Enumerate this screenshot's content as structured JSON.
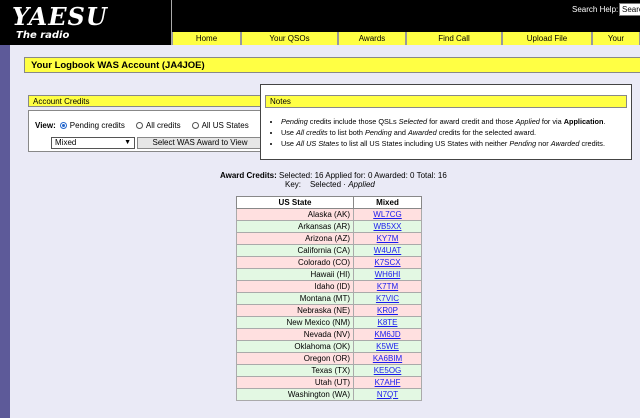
{
  "header": {
    "logo_text": "YAESU",
    "logo_sub": "The radio",
    "search_label": "Search Help:",
    "search_value": "Searc"
  },
  "nav": [
    {
      "label": "Home"
    },
    {
      "label": "Your QSOs"
    },
    {
      "label": "Awards"
    },
    {
      "label": "Find Call"
    },
    {
      "label": "Upload File"
    },
    {
      "label": "Your"
    }
  ],
  "page_title": "Your Logbook WAS Account (JA4JOE)",
  "account_credits": {
    "title": "Account Credits",
    "view_label": "View:",
    "options": [
      "Pending credits",
      "All credits",
      "All US States"
    ],
    "selected_option": "Pending credits",
    "select_value": "Mixed",
    "button_label": "Select WAS Award to View"
  },
  "notes": {
    "title": "Notes",
    "items": [
      {
        "a": "Pending",
        "b": " credits include those QSLs ",
        "c": "Selected",
        "d": " for award credit and those ",
        "e": "Applied",
        "f": " for via ",
        "g": "Application",
        "h": "."
      },
      {
        "a": "Use ",
        "b": "All credits",
        "c": " to list both ",
        "d": "Pending",
        "e": " and ",
        "f": "Awarded",
        "g": " credits for the selected award.",
        "h": ""
      },
      {
        "a": "Use ",
        "b": "All US States",
        "c": " to list all US States including US States with neither ",
        "d": "Pending",
        "e": " nor ",
        "f": "Awarded",
        "g": " credits.",
        "h": ""
      }
    ]
  },
  "summary": {
    "label": "Award Credits:",
    "text": "Selected: 16 Applied for: 0 Awarded: 0 Total: 16",
    "key_label": "Key:",
    "key_selected": "Selected",
    "key_sep": " · ",
    "key_applied": "Applied"
  },
  "table": {
    "headers": [
      "US State",
      "Mixed"
    ],
    "rows": [
      {
        "state": "Alaska (AK)",
        "call": "WL7CG",
        "status": "pink"
      },
      {
        "state": "Arkansas (AR)",
        "call": "WB5XX",
        "status": "green"
      },
      {
        "state": "Arizona (AZ)",
        "call": "KY7M",
        "status": "pink"
      },
      {
        "state": "California (CA)",
        "call": "W4UAT",
        "status": "green"
      },
      {
        "state": "Colorado (CO)",
        "call": "K7SCX",
        "status": "pink"
      },
      {
        "state": "Hawaii (HI)",
        "call": "WH6HI",
        "status": "green"
      },
      {
        "state": "Idaho (ID)",
        "call": "K7TM",
        "status": "pink"
      },
      {
        "state": "Montana (MT)",
        "call": "K7VIC",
        "status": "green"
      },
      {
        "state": "Nebraska (NE)",
        "call": "KR0P",
        "status": "pink"
      },
      {
        "state": "New Mexico (NM)",
        "call": "K8TE",
        "status": "green"
      },
      {
        "state": "Nevada (NV)",
        "call": "KM6JD",
        "status": "pink"
      },
      {
        "state": "Oklahoma (OK)",
        "call": "K5WE",
        "status": "green"
      },
      {
        "state": "Oregon (OR)",
        "call": "KA6BIM",
        "status": "pink"
      },
      {
        "state": "Texas (TX)",
        "call": "KE5OG",
        "status": "green"
      },
      {
        "state": "Utah (UT)",
        "call": "K7AHF",
        "status": "pink"
      },
      {
        "state": "Washington (WA)",
        "call": "N7QT",
        "status": "green"
      }
    ]
  },
  "colors": {
    "header_bg": "#000000",
    "accent_yellow": "#ffff44",
    "sidebar": "#5d5a99",
    "content_bg": "#eaeaf6",
    "row_pink": "#ffe0e0",
    "row_green": "#e3f8e3",
    "link": "#1a1aee"
  }
}
